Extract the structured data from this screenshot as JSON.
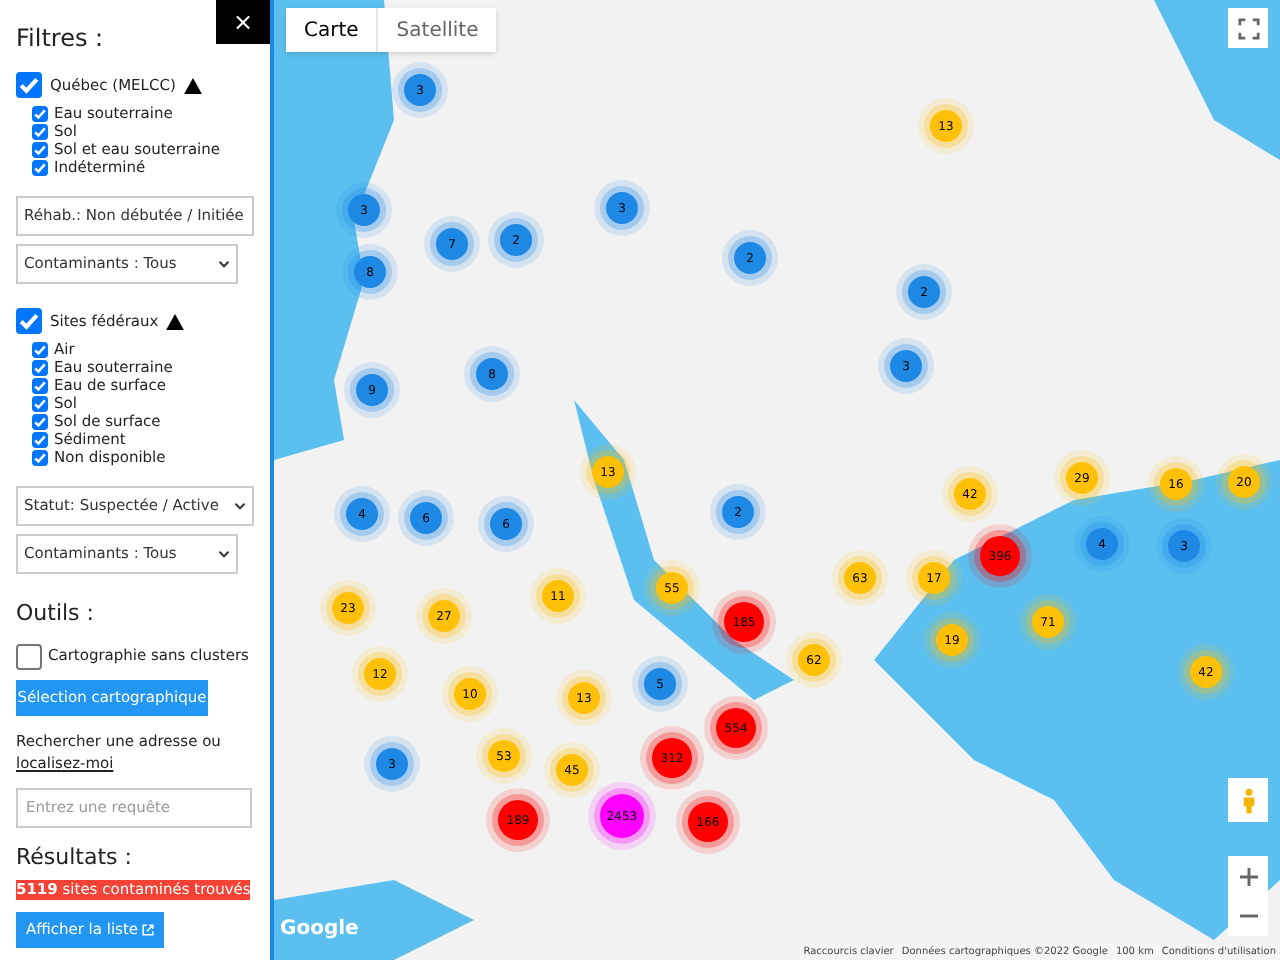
{
  "sidebar": {
    "close": "×",
    "title": "Filtres :",
    "groups": [
      {
        "label": "Québec (MELCC)",
        "checked": true,
        "items": [
          {
            "label": "Eau souterraine",
            "checked": true
          },
          {
            "label": "Sol",
            "checked": true
          },
          {
            "label": "Sol et eau souterraine",
            "checked": true
          },
          {
            "label": "Indéterminé",
            "checked": true
          }
        ],
        "selects": [
          "Réhab.: Non débutée / Initiée",
          "Contaminants : Tous"
        ]
      },
      {
        "label": "Sites fédéraux",
        "checked": true,
        "items": [
          {
            "label": "Air",
            "checked": true
          },
          {
            "label": "Eau souterraine",
            "checked": true
          },
          {
            "label": "Eau de surface",
            "checked": true
          },
          {
            "label": "Sol",
            "checked": true
          },
          {
            "label": "Sol de surface",
            "checked": true
          },
          {
            "label": "Sédiment",
            "checked": true
          },
          {
            "label": "Non disponible",
            "checked": true
          }
        ],
        "selects": [
          "Statut: Suspectée / Active",
          "Contaminants : Tous"
        ]
      }
    ],
    "tools_title": "Outils :",
    "no_clusters": {
      "label": "Cartographie sans clusters",
      "checked": false
    },
    "selection_button": "Sélection cartographique",
    "search_text": "Rechercher une adresse ou",
    "locate_link": "localisez-moi",
    "search": {
      "placeholder": "Entrez une requête"
    },
    "results_title": "Résultats :",
    "results_count": "5119",
    "results_text": "sites contaminés trouvés",
    "list_button": "Afficher la liste"
  },
  "map": {
    "tabs": [
      {
        "label": "Carte",
        "selected": true
      },
      {
        "label": "Satellite",
        "selected": false
      }
    ],
    "clusters": [
      {
        "count": "3",
        "color": "#1e88e5"
      },
      {
        "count": "13",
        "color": "#ffc107"
      },
      {
        "count": "3",
        "color": "#1e88e5"
      },
      {
        "count": "3",
        "color": "#1e88e5"
      },
      {
        "count": "2",
        "color": "#1e88e5"
      },
      {
        "count": "7",
        "color": "#1e88e5"
      },
      {
        "count": "2",
        "color": "#1e88e5"
      },
      {
        "count": "8",
        "color": "#1e88e5"
      },
      {
        "count": "2",
        "color": "#1e88e5"
      },
      {
        "count": "3",
        "color": "#1e88e5"
      },
      {
        "count": "8",
        "color": "#1e88e5"
      },
      {
        "count": "9",
        "color": "#1e88e5"
      },
      {
        "count": "13",
        "color": "#ffc107"
      },
      {
        "count": "29",
        "color": "#ffc107"
      },
      {
        "count": "16",
        "color": "#ffc107"
      },
      {
        "count": "20",
        "color": "#ffc107"
      },
      {
        "count": "42",
        "color": "#ffc107"
      },
      {
        "count": "4",
        "color": "#1e88e5"
      },
      {
        "count": "6",
        "color": "#1e88e5"
      },
      {
        "count": "6",
        "color": "#1e88e5"
      },
      {
        "count": "2",
        "color": "#1e88e5"
      },
      {
        "count": "4",
        "color": "#1e88e5"
      },
      {
        "count": "3",
        "color": "#1e88e5"
      },
      {
        "count": "396",
        "color": "#ff0000"
      },
      {
        "count": "63",
        "color": "#ffc107"
      },
      {
        "count": "17",
        "color": "#ffc107"
      },
      {
        "count": "55",
        "color": "#ffc107"
      },
      {
        "count": "11",
        "color": "#ffc107"
      },
      {
        "count": "23",
        "color": "#ffc107"
      },
      {
        "count": "27",
        "color": "#ffc107"
      },
      {
        "count": "185",
        "color": "#ff0000"
      },
      {
        "count": "71",
        "color": "#ffc107"
      },
      {
        "count": "19",
        "color": "#ffc107"
      },
      {
        "count": "62",
        "color": "#ffc107"
      },
      {
        "count": "42",
        "color": "#ffc107"
      },
      {
        "count": "12",
        "color": "#ffc107"
      },
      {
        "count": "5",
        "color": "#1e88e5"
      },
      {
        "count": "10",
        "color": "#ffc107"
      },
      {
        "count": "13",
        "color": "#ffc107"
      },
      {
        "count": "554",
        "color": "#ff0000"
      },
      {
        "count": "53",
        "color": "#ffc107"
      },
      {
        "count": "312",
        "color": "#ff0000"
      },
      {
        "count": "3",
        "color": "#1e88e5"
      },
      {
        "count": "45",
        "color": "#ffc107"
      },
      {
        "count": "2453",
        "color": "#ff00ff"
      },
      {
        "count": "189",
        "color": "#ff0000"
      },
      {
        "count": "166",
        "color": "#ff0000"
      }
    ],
    "footer": [
      "Raccourcis clavier",
      "Données cartographiques ©2022 Google",
      "100 km",
      "Conditions d'utilisation"
    ],
    "logo": "Google"
  }
}
